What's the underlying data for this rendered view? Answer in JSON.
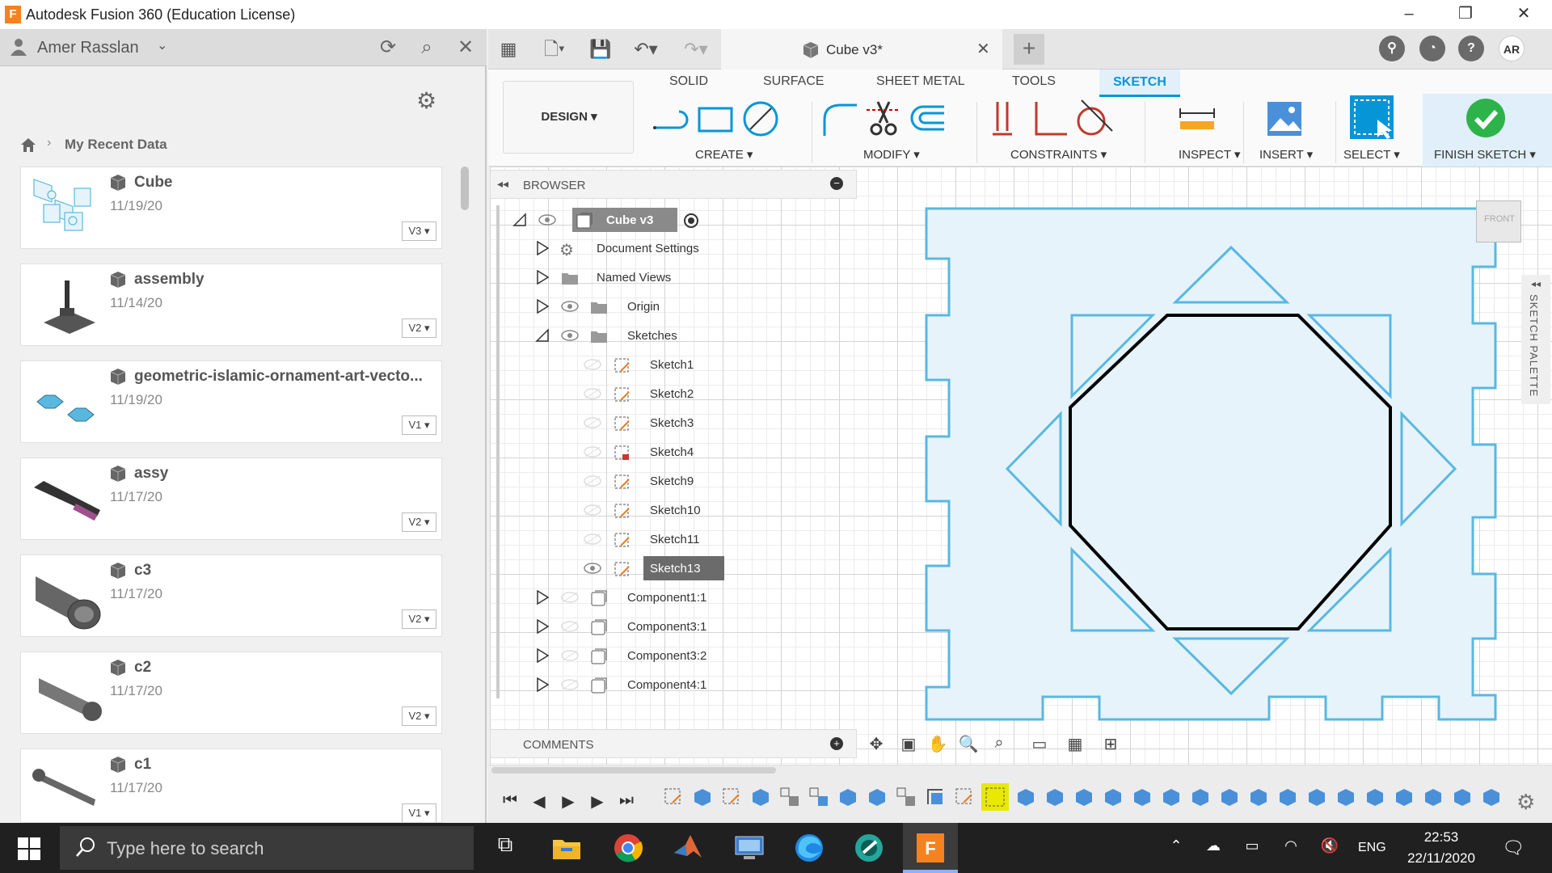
{
  "window": {
    "title": "Autodesk Fusion 360 (Education License)",
    "logo_letter": "F",
    "minimize": "–",
    "restore": "❐",
    "close": "✕"
  },
  "data_panel": {
    "user_name": "Amer Rasslan",
    "breadcrumb": "My Recent Data",
    "files": [
      {
        "name": "Cube",
        "date": "11/19/20",
        "version": "V3 ▾"
      },
      {
        "name": "assembly",
        "date": "11/14/20",
        "version": "V2 ▾"
      },
      {
        "name": "geometric-islamic-ornament-art-vecto...",
        "date": "11/19/20",
        "version": "V1 ▾"
      },
      {
        "name": "assy",
        "date": "11/17/20",
        "version": "V2 ▾"
      },
      {
        "name": "c3",
        "date": "11/17/20",
        "version": "V2 ▾"
      },
      {
        "name": "c2",
        "date": "11/17/20",
        "version": "V2 ▾"
      },
      {
        "name": "c1",
        "date": "11/17/20",
        "version": "V1 ▾"
      }
    ]
  },
  "document_tab": {
    "title": "Cube v3*",
    "close": "✕"
  },
  "profile": {
    "initials": "AR"
  },
  "ribbon": {
    "workspace": "DESIGN ▾",
    "tabs": [
      "SOLID",
      "SURFACE",
      "SHEET METAL",
      "TOOLS",
      "SKETCH"
    ],
    "groups": [
      "CREATE ▾",
      "MODIFY ▾",
      "CONSTRAINTS ▾",
      "INSPECT ▾",
      "INSERT ▾",
      "SELECT ▾",
      "FINISH SKETCH ▾"
    ]
  },
  "browser": {
    "title": "BROWSER",
    "root": "Cube v3",
    "items": {
      "document_settings": "Document Settings",
      "named_views": "Named Views",
      "origin": "Origin",
      "sketches": "Sketches",
      "sketch_list": [
        "Sketch1",
        "Sketch2",
        "Sketch3",
        "Sketch4",
        "Sketch9",
        "Sketch10",
        "Sketch11",
        "Sketch13"
      ],
      "components": [
        "Component1:1",
        "Component3:1",
        "Component3:2",
        "Component4:1"
      ]
    }
  },
  "comments": {
    "title": "COMMENTS"
  },
  "viewcube": {
    "label": "FRONT"
  },
  "sketch_palette": {
    "label": "SKETCH PALETTE"
  },
  "taskbar": {
    "search_placeholder": "Type here to search",
    "language": "ENG",
    "time": "22:53",
    "date": "22/11/2020"
  },
  "colors": {
    "accent": "#0696d7",
    "sketch_line": "#5ab8e0",
    "sketch_fill": "#e6f3fb",
    "profile_line": "#000000",
    "autodesk_orange": "#f58220"
  }
}
